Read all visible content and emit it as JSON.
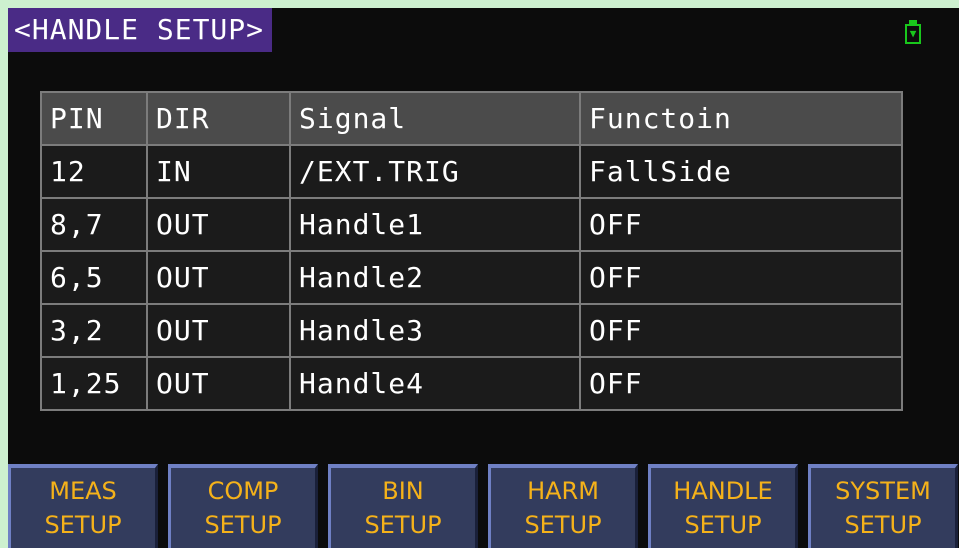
{
  "header": {
    "title": "<HANDLE SETUP>",
    "usb_icon": "usb-drive-icon",
    "usb_color": "#19c71c"
  },
  "table": {
    "headers": [
      "PIN",
      "DIR",
      "Signal",
      "Functoin"
    ],
    "rows": [
      [
        "12",
        "IN",
        "/EXT.TRIG",
        "FallSide"
      ],
      [
        "8,7",
        "OUT",
        "Handle1",
        "OFF"
      ],
      [
        "6,5",
        "OUT",
        "Handle2",
        "OFF"
      ],
      [
        "3,2",
        "OUT",
        "Handle3",
        "OFF"
      ],
      [
        "1,25",
        "OUT",
        "Handle4",
        "OFF"
      ]
    ]
  },
  "softkeys": [
    {
      "line1": "MEAS",
      "line2": "SETUP"
    },
    {
      "line1": "COMP",
      "line2": "SETUP"
    },
    {
      "line1": "BIN",
      "line2": "SETUP"
    },
    {
      "line1": "HARM",
      "line2": "SETUP"
    },
    {
      "line1": "HANDLE",
      "line2": "SETUP"
    },
    {
      "line1": "SYSTEM",
      "line2": "SETUP"
    }
  ],
  "colors": {
    "title_bg": "#4a2b86",
    "softkey_bg": "#333c5d",
    "softkey_text": "#f5b21a",
    "header_row_bg": "#4b4b4b"
  }
}
